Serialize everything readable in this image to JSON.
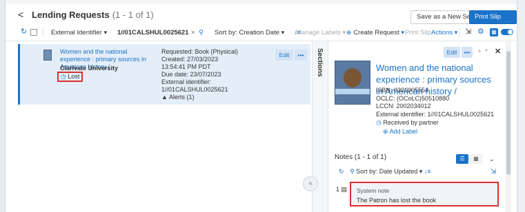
{
  "header": {
    "back_glyph": "<",
    "title": "Lending Requests",
    "count": "(1 - 1 of 1)",
    "save_new_set": "Save as a New Set",
    "print_slip_report": "Print Slip Report"
  },
  "toolbar": {
    "filter_field": "External Identifier",
    "search_value": "1//01CALSHUL0025621",
    "clear_glyph": "×",
    "sort_label": "Sort by:",
    "sort_value": "Creation Date",
    "manage_labels": "Manage Labels",
    "create_request": "Create Request",
    "print_slip": "Print Slip",
    "actions": "Actions"
  },
  "list": {
    "rows": [
      {
        "num": "1",
        "title": "Women and the national experience : primary sources in American history /",
        "partner": "Clarivate University",
        "status": "Lost",
        "requested": "Requested: Book (Physical)",
        "created": "Created: 27/03/2023",
        "created_time": "13:54:41 PM PDT",
        "due": "Due date: 23/07/2023",
        "ext_id_label": "External identifier:",
        "ext_id_value": "1//01CALSHUL0025621",
        "alerts": "Alerts (1)",
        "edit": "Edit",
        "more": "•••"
      }
    ]
  },
  "sections": {
    "label": "Sections",
    "collapse_glyph": "«"
  },
  "detail": {
    "edit": "Edit",
    "more": "•••",
    "close_glyph": "✕",
    "title": "Women and the national experience : primary sources in American history /",
    "isbn": "ISBN: 0321005554",
    "oclc": "OCLC: (OCoLC)50510880",
    "lccn": "LCCN:  2002034012",
    "ext_id": "External identifier: 1//01CALSHUL0025621",
    "received": "Received by partner",
    "add_label": "Add Label"
  },
  "notes": {
    "header": "Notes (1 - 1 of 1)",
    "sort_label": "Sort by:",
    "sort_value": "Date Updated",
    "items": [
      {
        "num": "1",
        "type": "System note",
        "text": "The Patron has lost the book"
      }
    ]
  },
  "colors": {
    "primary": "#1a73c8",
    "highlight_border": "#d9302c",
    "selected_row": "#e4eef9"
  },
  "icons": [
    "back-icon",
    "refresh-icon",
    "search-icon",
    "sort-icon",
    "plus-circle-icon",
    "clock-icon",
    "alert-icon",
    "close-icon",
    "list-view-icon",
    "grid-view-icon",
    "export-icon",
    "collapse-icon",
    "note-icon"
  ]
}
